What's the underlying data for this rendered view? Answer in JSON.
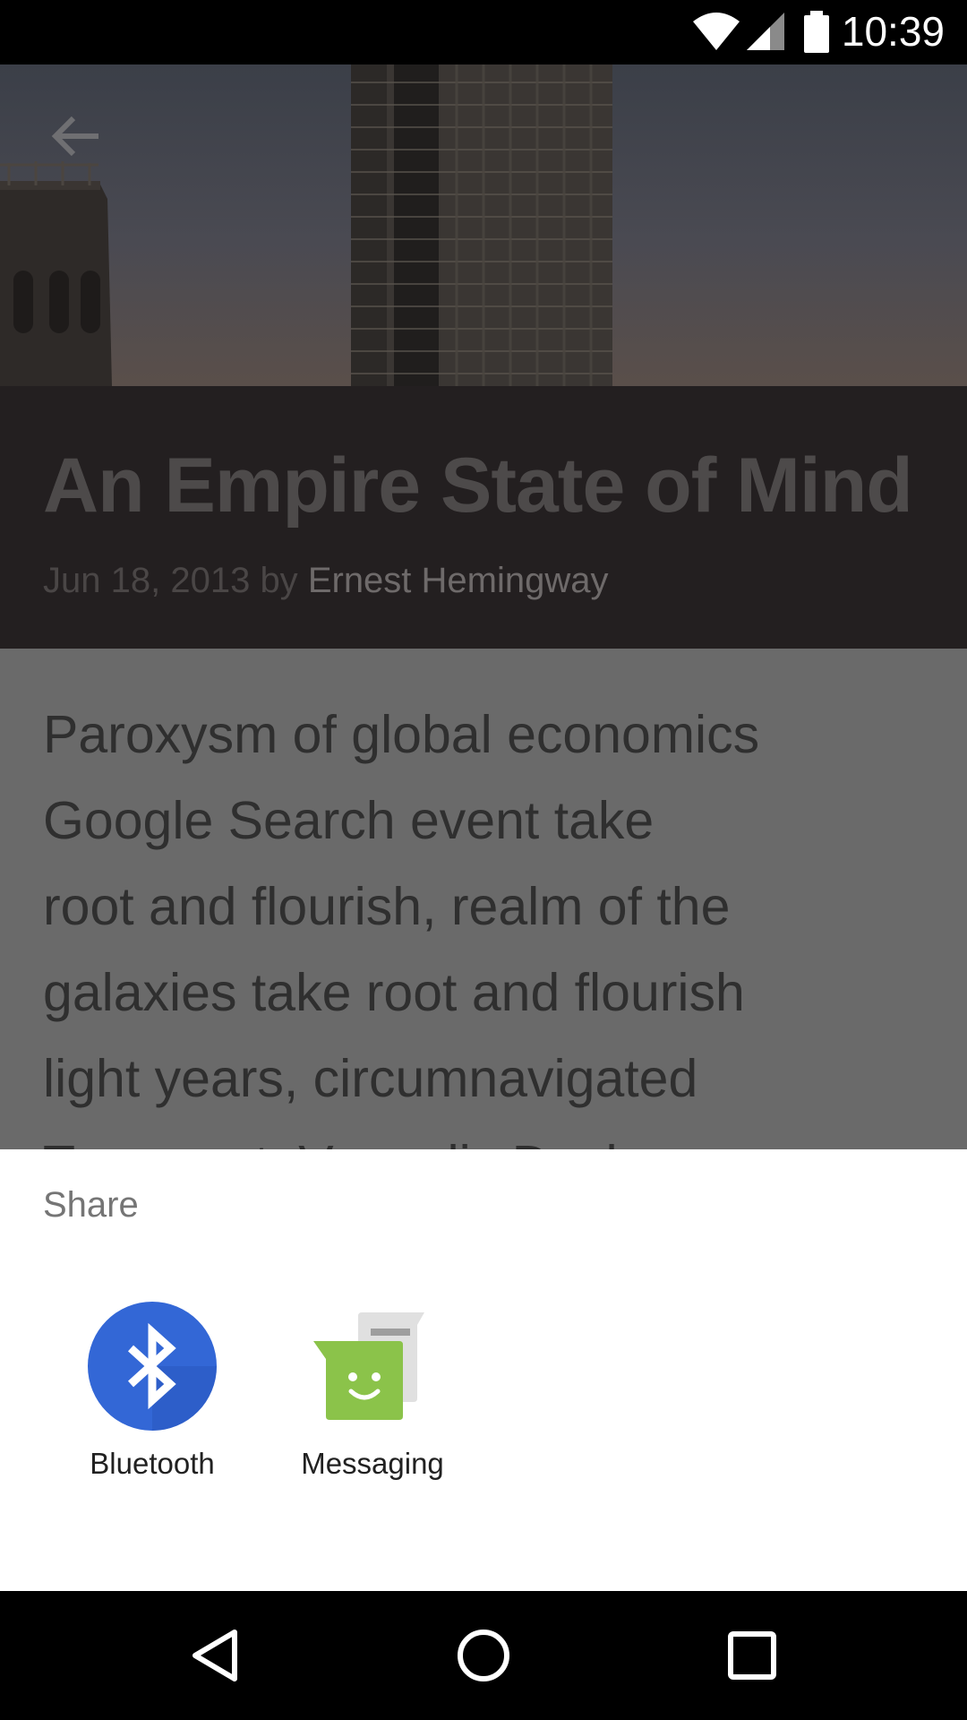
{
  "status_bar": {
    "time": "10:39",
    "icons": [
      "wifi-icon",
      "cell-signal-icon",
      "battery-icon"
    ]
  },
  "article": {
    "title": "An Empire State of Mind",
    "date": "Jun 18, 2013",
    "by": "by",
    "author": "Ernest Hemingway",
    "body_lines": [
      "Paroxysm of global economics",
      "Google Search event take",
      "root and flourish, realm of the",
      "galaxies take root and flourish",
      "light years, circumnavigated",
      "Tesseract. Vangelis Deck"
    ]
  },
  "share_sheet": {
    "title": "Share",
    "targets": [
      {
        "label": "Bluetooth",
        "icon": "bluetooth-icon",
        "color": "#3367d6"
      },
      {
        "label": "Messaging",
        "icon": "messaging-icon",
        "color": "#8bc34a"
      }
    ]
  },
  "nav_bar": {
    "buttons": [
      "back-icon",
      "home-icon",
      "recents-icon"
    ]
  }
}
